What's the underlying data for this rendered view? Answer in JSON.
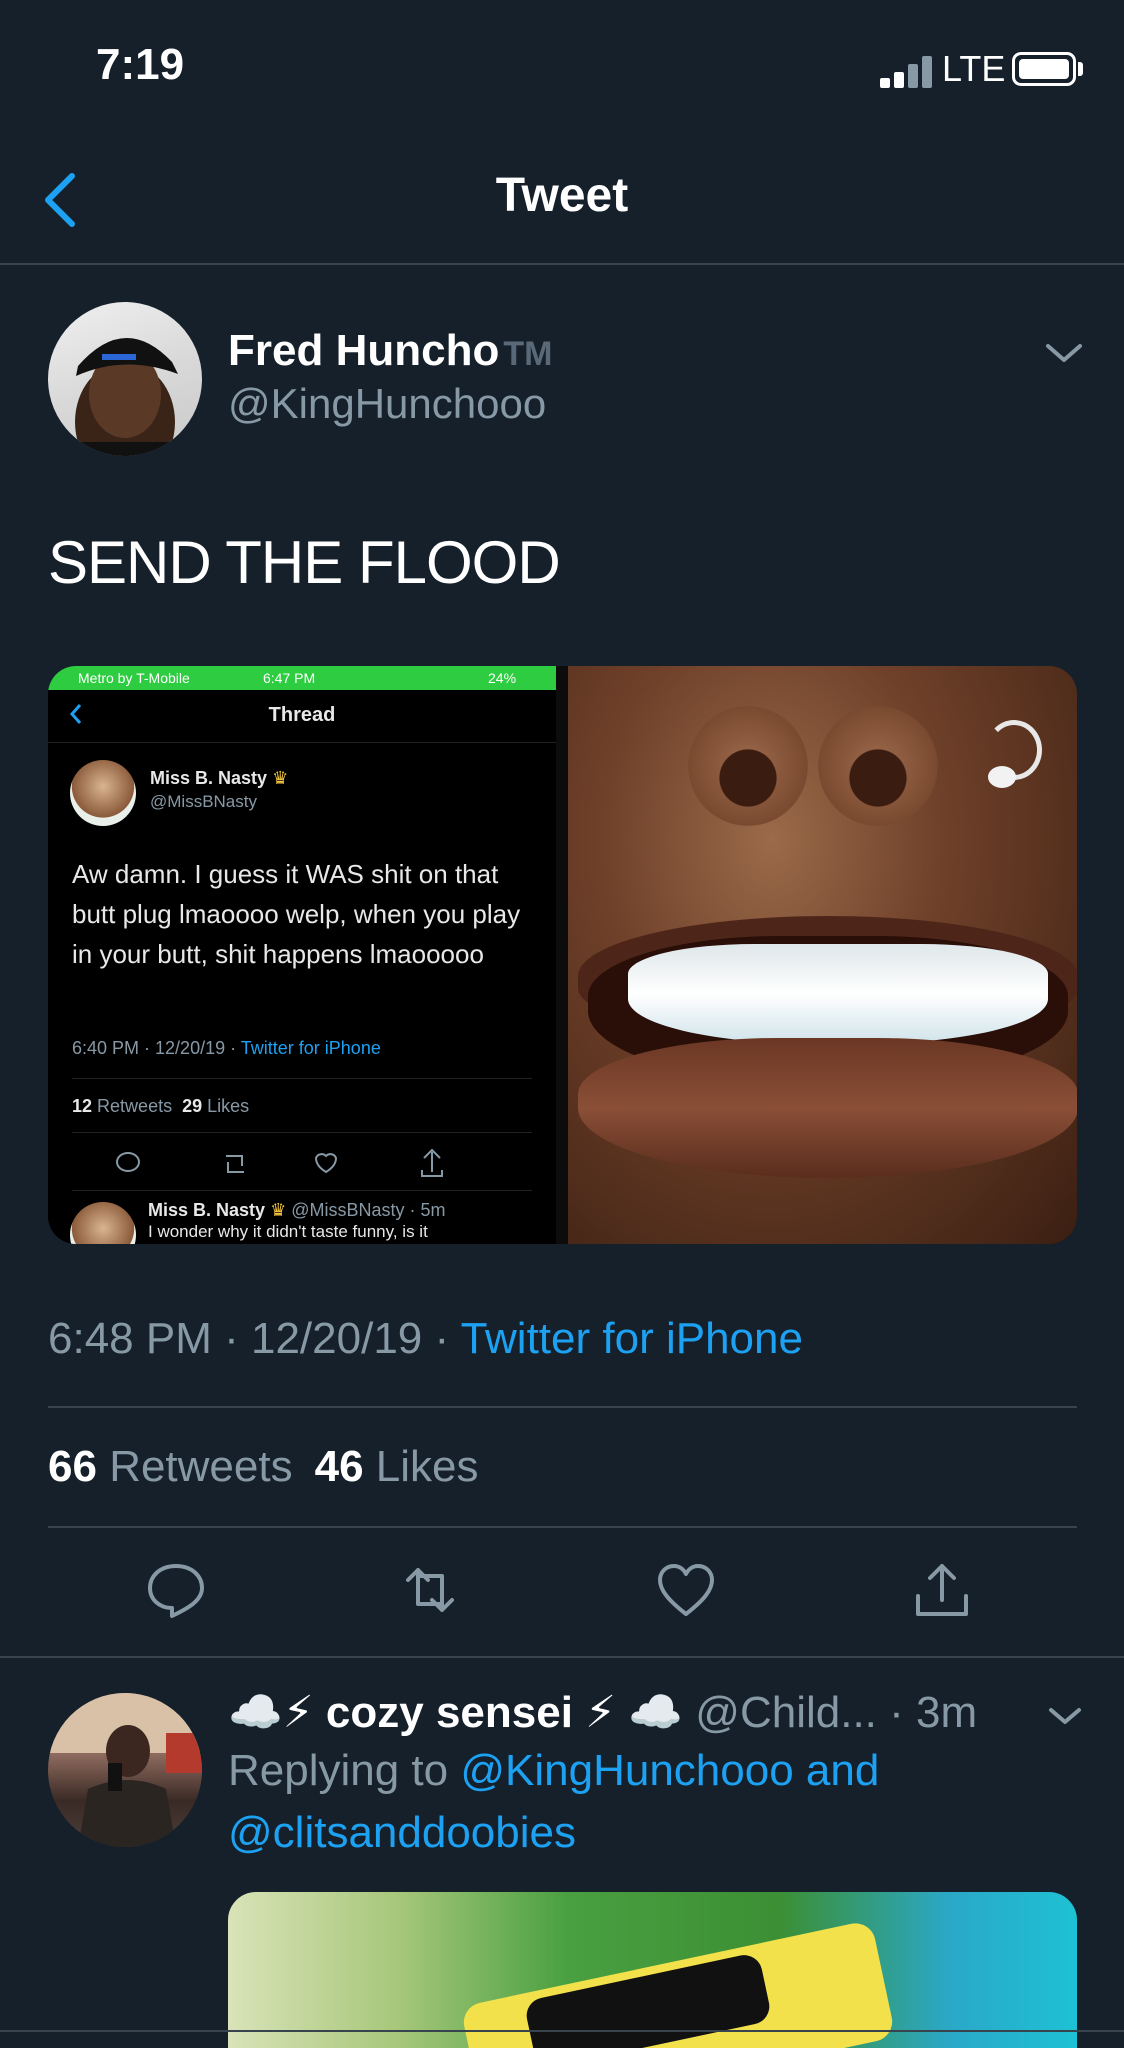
{
  "status_bar": {
    "time": "7:19",
    "network": "LTE"
  },
  "header": {
    "title": "Tweet"
  },
  "tweet": {
    "author_name": "Fred Huncho",
    "author_suffix": "TM",
    "author_handle": "@KingHunchooo",
    "text": "SEND THE FLOOD",
    "time": "6:48 PM",
    "date": "12/20/19",
    "source": "Twitter for iPhone",
    "retweets_count": "66",
    "retweets_label": "Retweets",
    "likes_count": "46",
    "likes_label": "Likes"
  },
  "embedded_screenshot": {
    "carrier": "Metro by T-Mobile",
    "time": "6:47 PM",
    "battery": "24%",
    "title": "Thread",
    "author_name": "Miss B. Nasty",
    "author_handle": "@MissBNasty",
    "text": "Aw damn. I guess it WAS shit on that butt plug lmaoooo welp, when you play in your butt, shit happens lmaooooo",
    "meta": "6:40 PM · 12/20/19 · ",
    "source": "Twitter for iPhone",
    "retweets_count": "12",
    "retweets_label": "Retweets",
    "likes_count": "29",
    "likes_label": "Likes",
    "reply_author": "Miss B. Nasty",
    "reply_handle": "@MissBNasty · 5m",
    "reply_text": "I wonder why it didn't taste funny, is it"
  },
  "reply": {
    "name": "☁️⚡ cozy sensei ⚡ ☁️",
    "handle_time": "@Child... · 3m",
    "replying_prefix": "Replying to ",
    "replying_mention_1": "@KingHunchooo and",
    "replying_mention_2": "@clitsanddoobies"
  },
  "colors": {
    "background": "#15202b",
    "accent": "#1da1f2",
    "secondary_text": "#8899a6",
    "divider": "#38444d"
  },
  "icons": [
    "back-chevron-icon",
    "chevron-down-icon",
    "reply-icon",
    "retweet-icon",
    "like-icon",
    "share-icon"
  ]
}
